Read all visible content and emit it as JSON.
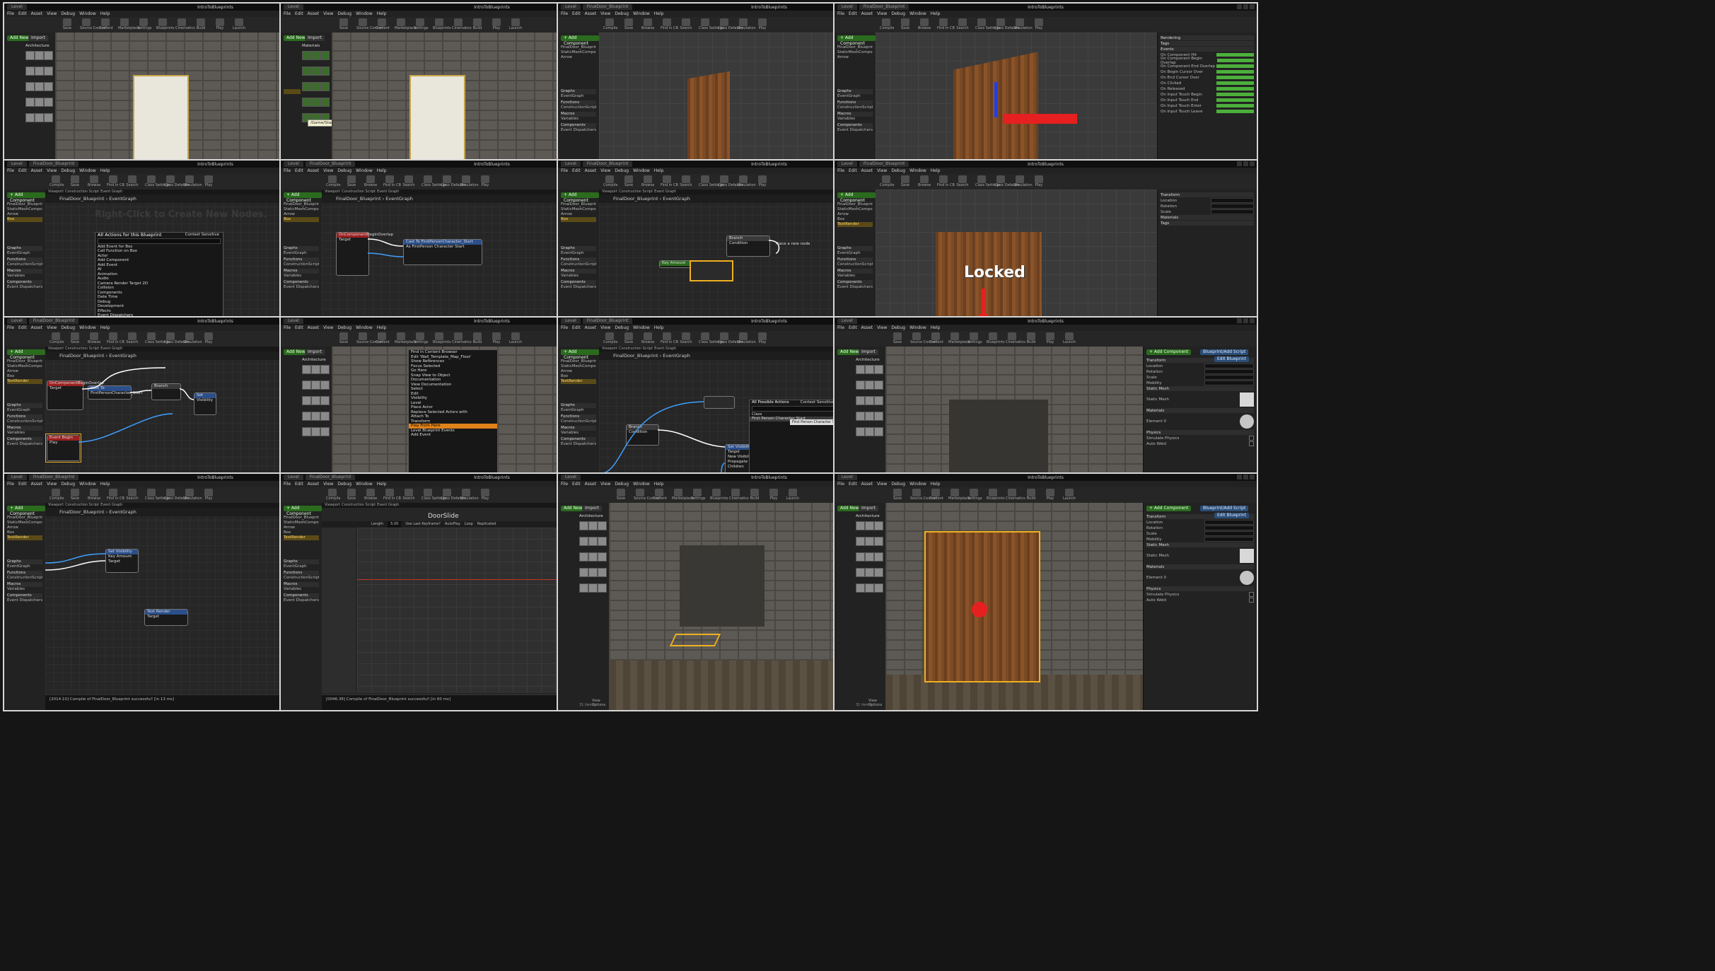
{
  "project_title": "IntroToBlueprints",
  "menu": [
    "File",
    "Edit",
    "Asset",
    "View",
    "Debug",
    "Window",
    "Help"
  ],
  "editor_toolbar": [
    "Save",
    "Source Control",
    "Content",
    "Marketplace",
    "Settings",
    "Blueprints",
    "Cinematics",
    "Build",
    "Play",
    "Launch"
  ],
  "bp_toolbar": [
    "Compile",
    "Save",
    "Browse",
    "Find in CB",
    "Search",
    "Class Settings",
    "Class Defaults",
    "Simulation",
    "Play"
  ],
  "tab_level": "Level",
  "tab_blueprint": "FinalDoor_Blueprint",
  "add_new": "Add New",
  "import": "Import",
  "add_component": "+ Add Component",
  "bp_add_script": "Blueprint/Add Script",
  "edit_blueprint": "Edit Blueprint",
  "filter": "Filters",
  "folders": {
    "architecture": "Architecture",
    "materials": "Materials"
  },
  "tooltip_path": "/Game/StarterContent/Materials",
  "bp_tabs": [
    "Viewport",
    "Construction Script",
    "Event Graph"
  ],
  "graph_path": "FinalDoor_Blueprint › EventGraph",
  "watermark": "BLUEPRINT",
  "right_click_hint": "Right-Click to Create New Nodes.",
  "actions_title": "All Actions for this Blueprint",
  "context_sensitive": "Context Sensitive",
  "actions_list": [
    "Add Event for Box",
    "Call Function on Box",
    "Actor",
    "Add Component",
    "Add Event",
    "AI",
    "Animation",
    "Audio",
    "Camera Render Target 2D",
    "Collision",
    "Components",
    "Date Time",
    "Debug",
    "Development",
    "Effects",
    "Event Dispatchers",
    "Forest",
    "Functional Testing"
  ],
  "components_title": "Components",
  "components": [
    "FinalDoor_Blueprint (self)",
    "StaticMeshComponent (Inherited)",
    "Arrow",
    "Box",
    "TextRender"
  ],
  "my_blueprint_sections": [
    "Graphs",
    "EventGraph",
    "Functions",
    "ConstructionScript",
    "Macros",
    "Variables",
    "Components",
    "Event Dispatchers"
  ],
  "events": [
    "Event Begin Play",
    "Event Actor Begin Overlap",
    "Event Tick",
    "OnComponentBeginOverlap"
  ],
  "detail_sections": [
    "Transform",
    "Static Mesh",
    "Materials",
    "Physics",
    "Collision",
    "Rendering",
    "Tags",
    "Events",
    "Lighting",
    "Game Mode",
    "World"
  ],
  "detail_labels": [
    "Location",
    "Rotation",
    "Scale",
    "Mobility",
    "Static Mesh",
    "Element 0",
    "Simulate Physics",
    "Auto Weld",
    "Generate Overlap Events",
    "Hidden in Game",
    "Visible"
  ],
  "event_pins": [
    "On Component Hit",
    "On Component Begin Overlap",
    "On Component End Overlap",
    "On Begin Cursor Over",
    "On End Cursor Over",
    "On Clicked",
    "On Released",
    "On Input Touch Begin",
    "On Input Touch End",
    "On Input Touch Enter",
    "On Input Touch Leave"
  ],
  "node_cast": "Cast To FirstPersonCharacter_Start",
  "node_as_char": "As FirstPerson Character Start",
  "node_branch": "Branch",
  "node_condition": "Condition",
  "node_true": "True",
  "node_false": "False",
  "node_place_new": "Place a new node",
  "node_target": "Target",
  "node_key_amount": "Key Amount",
  "node_set_visibility": "Set Visibility",
  "node_new_visibility": "New Visibility",
  "node_propagate": "Propagate to Children",
  "node_text_render": "Text Render",
  "all_possible_actions": "All Possible Actions",
  "class_label": "Class",
  "first_person_start": "First Person Character Start",
  "text_locked": "Locked",
  "timeline_title": "DoorSlide",
  "timeline_length_label": "Length",
  "timeline_length": "5.00",
  "timeline_toggles": [
    "Use Last Keyframe?",
    "AutoPlay",
    "Loop",
    "Replicated"
  ],
  "compile_log_1": "[2014.10] Compile of FinalDoor_Blueprint successful! [in 13 ms]",
  "compile_log_2": "[0046.38] Compile of FinalDoor_Blueprint successful! [in 60 ms]",
  "clear": "Clear",
  "view_options": "View Options",
  "items_count": "31 items",
  "asset_ctx": [
    "Find in Content Browser",
    "Edit 'Wall_Template_Map_Floor'",
    "Show References",
    "Focus Selected",
    "Go Here",
    "Snap View to Object",
    "Documentation",
    "View Documentation",
    "Select",
    "Edit",
    "Visibility",
    "Level",
    "Place Actor",
    "Replace Selected Actors with",
    "Attach To",
    "Transform",
    "Play From Here",
    "Level Blueprint Events",
    "Add Event"
  ],
  "sub_ctx": [
    "OnActorBeginOverlap",
    "OnActorEndOverlap",
    "OnActorHit",
    "OnBeginCursorOver",
    "OnClicked",
    "OnEndCursorOver",
    "OnInputTouchBegin",
    "OnReleased"
  ],
  "colors": {
    "accent_green": "#4caf3c",
    "select_gold": "#f0b020",
    "blue_btn": "#2a4d78",
    "exec_white": "#ffffff",
    "pin_blue": "#3ea0ff",
    "pin_red": "#e63030"
  }
}
